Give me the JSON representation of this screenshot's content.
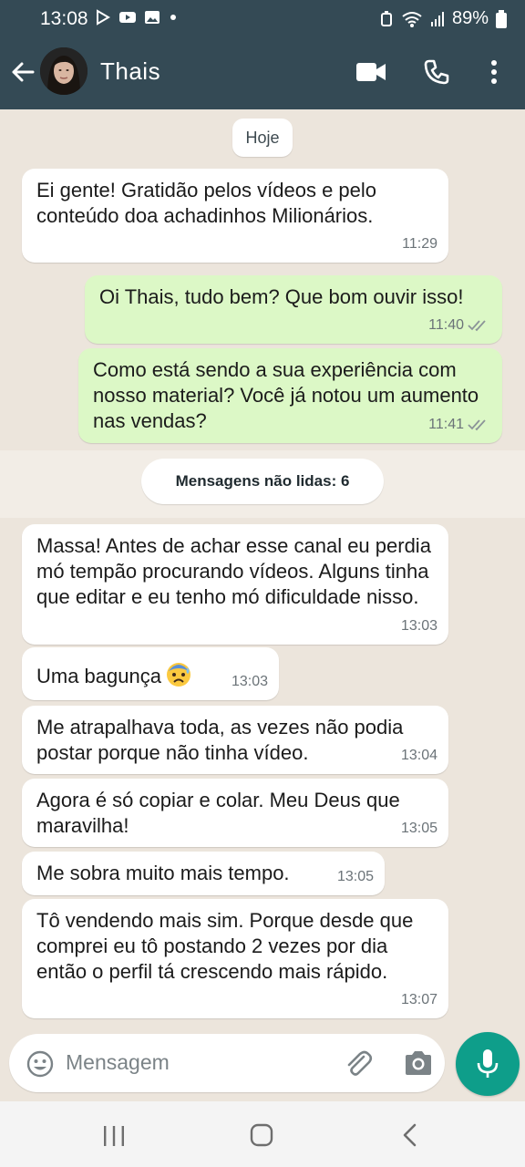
{
  "status": {
    "time": "13:08",
    "battery": "89%"
  },
  "header": {
    "name": "Thais"
  },
  "chat": {
    "date_label": "Hoje",
    "unread_label": "Mensagens não lidas: 6",
    "messages": [
      {
        "dir": "in",
        "text": "Ei gente! Gratidão pelos vídeos e pelo conteúdo doa achadinhos Milionários.",
        "time": "11:29"
      },
      {
        "dir": "out",
        "text": "Oi Thais, tudo bem? Que bom ouvir isso!",
        "time": "11:40"
      },
      {
        "dir": "out",
        "text": "Como está sendo a sua experiência com nosso material? Você já notou um aumento nas vendas?",
        "time": "11:41"
      },
      {
        "dir": "in",
        "text": "Massa! Antes de achar esse canal eu perdia mó tempão procurando vídeos. Alguns tinha que editar e eu tenho mó dificuldade nisso.",
        "time": "13:03"
      },
      {
        "dir": "in",
        "text": "Uma bagunça",
        "time": "13:03"
      },
      {
        "dir": "in",
        "text": "Me atrapalhava toda, as vezes não podia postar porque não tinha vídeo.",
        "time": "13:04"
      },
      {
        "dir": "in",
        "text": "Agora é só copiar e colar. Meu Deus que maravilha!",
        "time": "13:05"
      },
      {
        "dir": "in",
        "text": "Me sobra muito mais tempo.",
        "time": "13:05"
      },
      {
        "dir": "in",
        "text": "Tô vendendo mais sim. Porque desde que comprei eu tô postando 2 vezes por dia então o perfil tá crescendo mais rápido.",
        "time": "13:07"
      }
    ]
  },
  "input": {
    "placeholder": "Mensagem"
  },
  "icons": {
    "back": "arrow-left-icon",
    "video": "video-call-icon",
    "call": "phone-icon",
    "more": "more-vert-icon",
    "emoji": "emoji-icon",
    "attach": "paperclip-icon",
    "camera": "camera-icon",
    "mic": "microphone-icon",
    "read": "double-check-icon",
    "worried": "anxious-sweat-face-emoji"
  },
  "colors": {
    "header": "#344a55",
    "outgoing": "#dcf8c6",
    "incoming": "#ffffff",
    "accent": "#0e9e8a",
    "background": "#ece5dc"
  }
}
